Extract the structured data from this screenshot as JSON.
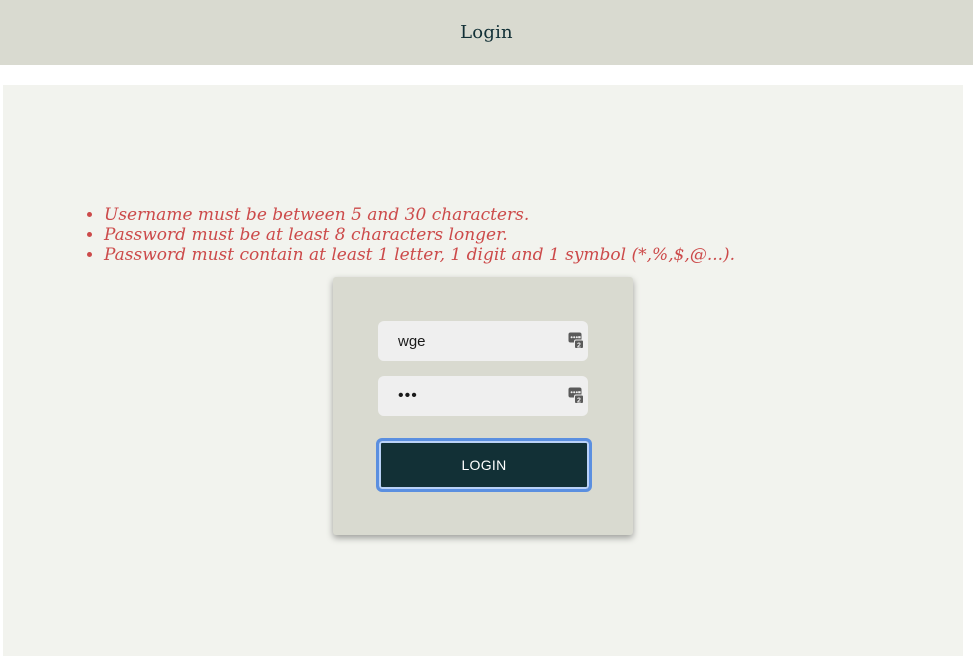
{
  "header": {
    "title": "Login"
  },
  "errors": [
    "Username must be between 5 and 30 characters.",
    "Password must be at least 8 characters longer.",
    "Password must contain at least 1 letter, 1 digit and 1 symbol (*,%,$,@...)."
  ],
  "form": {
    "username_value": "wge",
    "password_value": "abc",
    "login_label": "LOGIN",
    "password_manager_icon": "password-manager-icon"
  },
  "colors": {
    "header_bg": "#d9dad0",
    "page_bg": "#f2f3ee",
    "error_text": "#cc4a4a",
    "button_bg": "#123036",
    "focus_ring": "#5b8fe0"
  }
}
